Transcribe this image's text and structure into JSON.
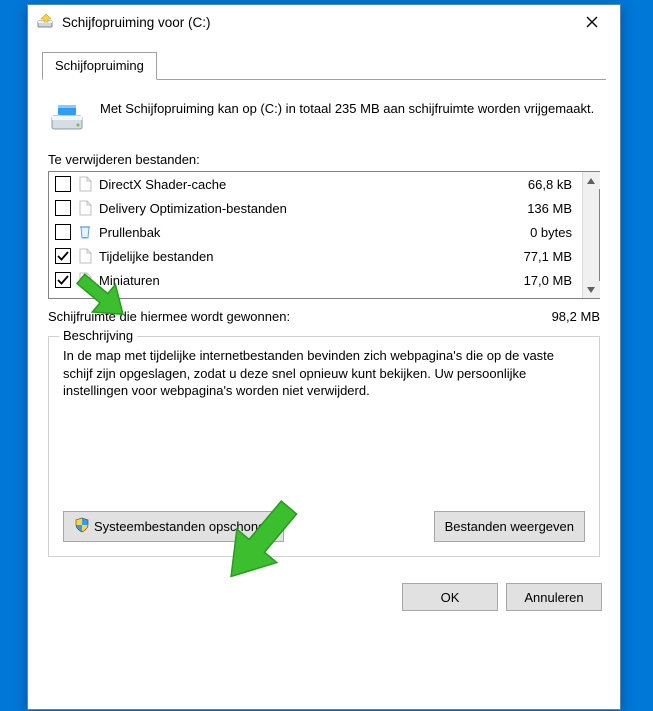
{
  "window": {
    "title": "Schijfopruiming voor  (C:)"
  },
  "tab": {
    "label": "Schijfopruiming"
  },
  "intro": "Met Schijfopruiming kan op  (C:) in totaal 235 MB aan schijfruimte worden vrijgemaakt.",
  "files_label": "Te verwijderen bestanden:",
  "files": [
    {
      "name": "DirectX Shader-cache",
      "size": "66,8 kB",
      "checked": false,
      "icon": "file"
    },
    {
      "name": "Delivery Optimization-bestanden",
      "size": "136 MB",
      "checked": false,
      "icon": "file"
    },
    {
      "name": "Prullenbak",
      "size": "0 bytes",
      "checked": false,
      "icon": "bin"
    },
    {
      "name": "Tijdelijke bestanden",
      "size": "77,1 MB",
      "checked": true,
      "icon": "file"
    },
    {
      "name": "Miniaturen",
      "size": "17,0 MB",
      "checked": true,
      "icon": "file"
    }
  ],
  "gain": {
    "label": "Schijfruimte die hiermee wordt gewonnen:",
    "value": "98,2 MB"
  },
  "description": {
    "legend": "Beschrijving",
    "text": "In de map met tijdelijke internetbestanden bevinden zich webpagina's die op de vaste schijf zijn opgeslagen, zodat u deze snel opnieuw kunt bekijken. Uw persoonlijke instellingen voor webpagina's worden niet verwijderd."
  },
  "buttons": {
    "clean_system": "Systeembestanden opschonen",
    "view_files": "Bestanden weergeven",
    "ok": "OK",
    "cancel": "Annuleren"
  }
}
